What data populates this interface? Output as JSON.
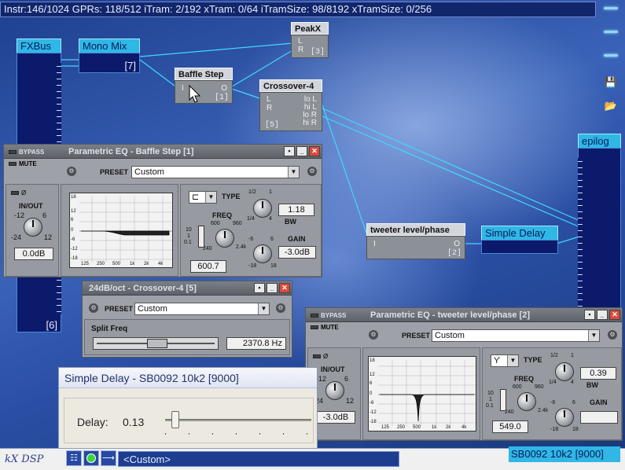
{
  "status_bar": {
    "text": "Instr:146/1024 GPRs: 118/512 iTram: 2/192 xTram: 0/64 iTramSize: 98/8192 xTramSize: 0/256"
  },
  "blocks": {
    "fxbus": {
      "title": "FXBus",
      "index": "[6]"
    },
    "mono_mix": {
      "title": "Mono Mix",
      "index": "[7]"
    },
    "peakx": {
      "title": "PeakX",
      "pin_l": "L",
      "pin_r": "R",
      "index": "[3]"
    },
    "baffle_step": {
      "title": "Baffle Step",
      "pin_in": "I",
      "pin_out": "O",
      "index": "[1]"
    },
    "crossover": {
      "title": "Crossover-4",
      "in_pins": [
        "L",
        "R"
      ],
      "out_pins": [
        "lo L",
        "hi L",
        "lo R",
        "hi R"
      ],
      "index": "[5]"
    },
    "tweeter": {
      "title": "tweeter level/phase",
      "pin_in": "I",
      "pin_out": "O",
      "index": "[2]"
    },
    "simple_delay": {
      "title": "Simple Delay"
    },
    "epilog": {
      "title": "epilog"
    }
  },
  "eq1": {
    "title": "Parametric EQ - Baffle Step [1]",
    "bypass": "BYPASS",
    "mute": "MUTE",
    "preset_label": "PRESET",
    "preset_value": "Custom",
    "phase_label": "Ø",
    "inout_label": "IN/OUT",
    "inout_ticks": [
      "-12",
      "6",
      "-24",
      "12"
    ],
    "inout_value": "0.0dB",
    "type_label": "TYPE",
    "freq_label": "FREQ",
    "freq_ticks": [
      "600",
      "960",
      "240",
      "2.4k"
    ],
    "freq_mult": [
      "10",
      "1",
      "0.1"
    ],
    "freq_value": "600.7",
    "bw_label": "BW",
    "bw_ticks": [
      "1/2",
      "1",
      "1/4",
      "4"
    ],
    "bw_value": "1.18",
    "gain_label": "GAIN",
    "gain_ticks": [
      "-6",
      "6",
      "-18",
      "18"
    ],
    "gain_value": "-3.0dB",
    "y_ticks": [
      "18",
      "12",
      "6",
      "0",
      "-6",
      "-12",
      "-18"
    ],
    "x_ticks": [
      "125",
      "250",
      "500",
      "1k",
      "2k",
      "4k"
    ]
  },
  "xover": {
    "title": "24dB/oct - Crossover-4 [5]",
    "preset_label": "PRESET",
    "preset_value": "Custom",
    "split_label": "Split Freq",
    "split_value": "2370.8 Hz"
  },
  "eq2": {
    "title": "Parametric EQ - tweeter level/phase [2]",
    "bypass": "BYPASS",
    "mute": "MUTE",
    "preset_label": "PRESET",
    "preset_value": "Custom",
    "phase_label": "Ø",
    "inout_label": "IN/OUT",
    "inout_ticks": [
      "-12",
      "6",
      "-24",
      "12"
    ],
    "inout_value": "-3.0dB",
    "type_label": "TYPE",
    "freq_label": "FREQ",
    "freq_ticks": [
      "600",
      "960",
      "240",
      "2.4k"
    ],
    "freq_mult": [
      "10",
      "1",
      "0.1"
    ],
    "freq_value": "549.0",
    "bw_label": "BW",
    "bw_ticks": [
      "1/2",
      "1",
      "1/4",
      "4"
    ],
    "bw_value": "0.39",
    "gain_label": "GAIN",
    "gain_ticks": [
      "-6",
      "6",
      "-18",
      "18"
    ],
    "gain_value": "",
    "y_ticks": [
      "18",
      "12",
      "6",
      "0",
      "-6",
      "-12",
      "-18"
    ],
    "x_ticks": [
      "125",
      "250",
      "500",
      "1k",
      "2k",
      "4k"
    ]
  },
  "delay_window": {
    "title": "Simple Delay - SB0092 10k2 [9000]",
    "delay_label": "Delay:",
    "delay_value": "0.13"
  },
  "bottom": {
    "logo": "kX DSP",
    "preset": "<Custom>",
    "device": "SB0092 10k2 [9000]"
  },
  "colors": {
    "desktop": "#2b4e9a",
    "cyan_block": "#2fb7e6",
    "navy_block": "#0c1a6b",
    "wire": "#40d8ff",
    "panel_grey": "#9ea2a8"
  }
}
